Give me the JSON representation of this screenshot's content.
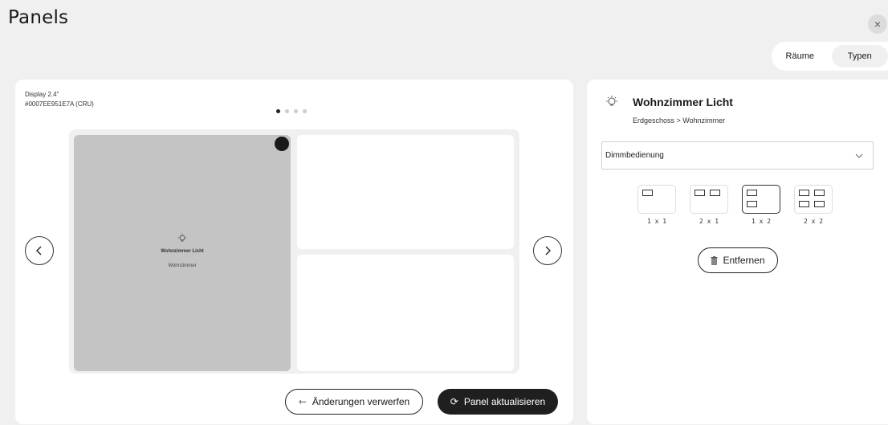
{
  "header": {
    "title": "Panels",
    "close_label": "×"
  },
  "view_toggle": {
    "options": [
      "Räume",
      "Typen"
    ],
    "active": "Typen"
  },
  "display": {
    "name": "Display 2.4\"",
    "id": "#0007EE951E7A (CRU)",
    "page_count": 4,
    "current_page": 1
  },
  "tile": {
    "name": "Wohnzimmer Licht",
    "room": "Wohnzimmer",
    "icon": "lightbulb-icon"
  },
  "actions": {
    "discard_label": "Änderungen verwerfen",
    "update_label": "Panel aktualisieren",
    "discard_icon": "⇽",
    "update_icon": "⟳"
  },
  "detail": {
    "icon": "lightbulb-icon",
    "title": "Wohnzimmer Licht",
    "path": "Erdgeschoss > Wohnzimmer",
    "control_type": "Dimmbedienung",
    "layouts": [
      {
        "label": "1 x 1"
      },
      {
        "label": "2 x 1"
      },
      {
        "label": "1 x 2"
      },
      {
        "label": "2 x 2"
      }
    ],
    "selected_layout": "1 x 2",
    "remove_label": "Entfernen"
  }
}
